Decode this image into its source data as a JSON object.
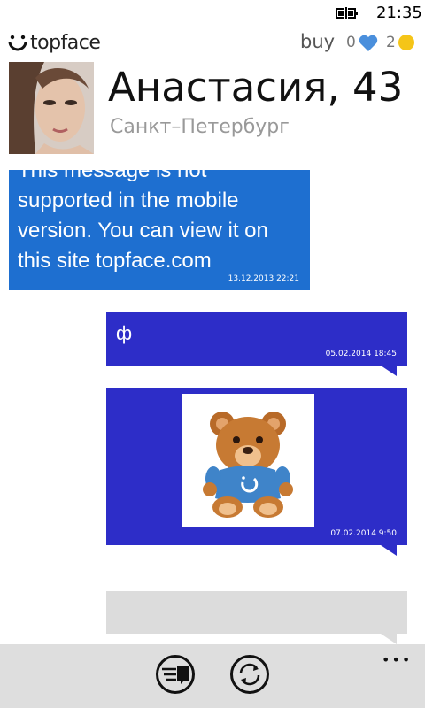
{
  "status": {
    "time": "21:35"
  },
  "header": {
    "logo_text": "topface",
    "buy_label": "buy",
    "likes_count": "0",
    "coins_count": "2",
    "heart_color": "#4a8fdc",
    "coin_color": "#f5c518"
  },
  "profile": {
    "name": "Анастасия, 43",
    "city": "Санкт–Петербург"
  },
  "messages": [
    {
      "direction": "incoming",
      "text_line_1": "This message is not",
      "text_line_2": "supported in the mobile",
      "text_line_3": "version. You can view it on",
      "text_line_4": "this site topface.com",
      "time": "13.12.2013 22:21"
    },
    {
      "direction": "outgoing",
      "text": "ф",
      "time": "05.02.2014 18:45"
    },
    {
      "direction": "outgoing",
      "sticker": "teddy-bear",
      "time": "07.02.2014 9:50"
    },
    {
      "direction": "outgoing",
      "state": "pending",
      "text": ""
    }
  ],
  "appbar": {
    "buttons": [
      "send-message",
      "refresh"
    ],
    "more_label": "•••"
  },
  "colors": {
    "incoming_bubble": "#1e6fd0",
    "outgoing_bubble": "#2d2dc8",
    "appbar": "#dedede"
  }
}
